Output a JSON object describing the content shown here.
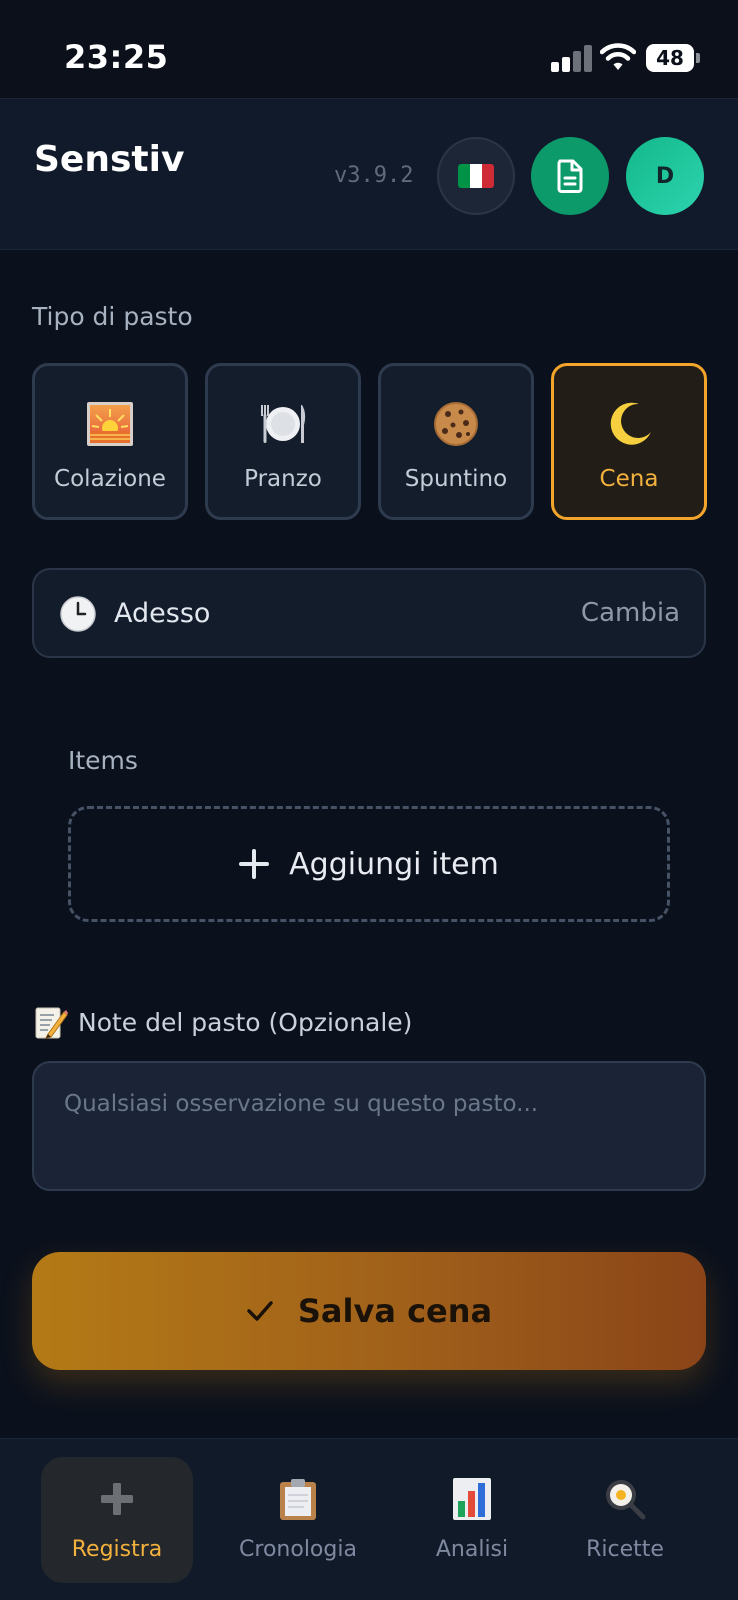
{
  "status_bar": {
    "time": "23:25",
    "battery": "48"
  },
  "header": {
    "title": "Senstiv",
    "version": "v3.9.2",
    "avatar_initial": "D",
    "flag_colors": [
      "#009246",
      "#ffffff",
      "#ce2b37"
    ]
  },
  "meal_type": {
    "label": "Tipo di pasto",
    "options": [
      {
        "label": "Colazione",
        "icon": "sunrise-icon"
      },
      {
        "label": "Pranzo",
        "icon": "plate-cutlery-icon"
      },
      {
        "label": "Spuntino",
        "icon": "cookie-icon"
      },
      {
        "label": "Cena",
        "icon": "crescent-moon-icon"
      }
    ],
    "selected": "Cena"
  },
  "time": {
    "label": "Adesso",
    "change": "Cambia"
  },
  "items": {
    "label": "Items",
    "add": "Aggiungi item"
  },
  "notes": {
    "label": "Note del pasto (Opzionale)",
    "placeholder": "Qualsiasi osservazione su questo pasto..."
  },
  "save": {
    "label": "Salva cena"
  },
  "nav": {
    "items": [
      {
        "label": "Registra",
        "icon": "plus-icon"
      },
      {
        "label": "Cronologia",
        "icon": "clipboard-icon"
      },
      {
        "label": "Analisi",
        "icon": "bar-chart-icon"
      },
      {
        "label": "Ricette",
        "icon": "fried-egg-pan-icon"
      }
    ],
    "active": "Registra"
  },
  "colors": {
    "accent": "#f2a52a",
    "background": "#0b111c",
    "green": "#0d9a6b"
  }
}
